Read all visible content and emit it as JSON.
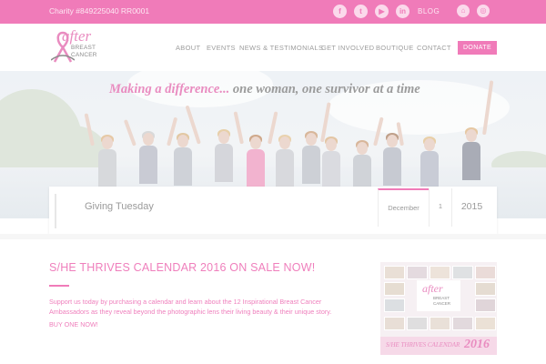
{
  "topbar": {
    "charity": "Charity #849225040 RR0001",
    "social": [
      {
        "icon": "facebook-icon",
        "glyph": "f"
      },
      {
        "icon": "twitter-icon",
        "glyph": "t"
      },
      {
        "icon": "youtube-icon",
        "glyph": "▶"
      },
      {
        "icon": "linkedin-icon",
        "glyph": "in"
      }
    ],
    "blog": "BLOG",
    "cart_icon": "cart-icon",
    "instagram_icon": "instagram-icon"
  },
  "logo": {
    "after": "after",
    "breast": "BREAST",
    "cancer": "CANCER"
  },
  "nav": [
    "ABOUT",
    "EVENTS",
    "NEWS & TESTIMONIALS",
    "GET INVOLVED",
    "BOUTIQUE",
    "CONTACT"
  ],
  "donate": "DONATE",
  "hero": {
    "tagline_pink": "Making a difference...",
    "tagline_grey": " one woman, one survivor at a time"
  },
  "event": {
    "title": "Giving Tuesday",
    "month": "December",
    "day": "1",
    "year": "2015"
  },
  "article": {
    "headline": "S/HE THRIVES CALENDAR 2016 ON SALE NOW!",
    "body": "Support us today by purchasing a calendar and learn about the 12 Inspirational Breast Cancer Ambassadors as they  reveal beyond the photographic lens their living beauty & their unique story.",
    "cta": "BUY ONE NOW!"
  },
  "calendar": {
    "after": "after",
    "breast": "BREAST",
    "cancer": "CANCER",
    "footer": "S/HE THRIVES CALENDAR",
    "year": "2016"
  },
  "colors": {
    "brand_pink": "#f07bb9",
    "text_grey": "#9a9a9a"
  }
}
